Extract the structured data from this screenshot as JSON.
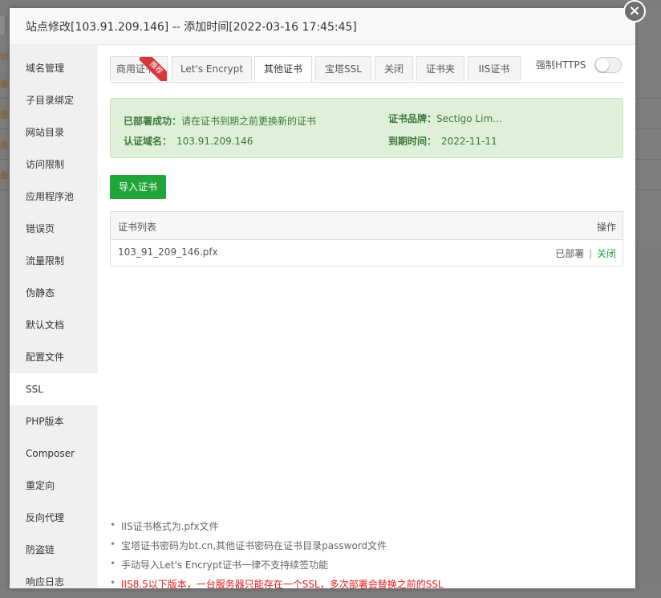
{
  "modal": {
    "title": "站点修改[103.91.209.146] -- 添加时间[2022-03-16 17:45:45]",
    "close_icon": "×"
  },
  "background": {
    "left_texts": [
      "价",
      "备",
      "备",
      "备",
      "备"
    ]
  },
  "sidebar": {
    "items": [
      {
        "label": "域名管理"
      },
      {
        "label": "子目录绑定"
      },
      {
        "label": "网站目录"
      },
      {
        "label": "访问限制"
      },
      {
        "label": "应用程序池"
      },
      {
        "label": "错误页"
      },
      {
        "label": "流量限制"
      },
      {
        "label": "伪静态"
      },
      {
        "label": "默认文档"
      },
      {
        "label": "配置文件"
      },
      {
        "label": "SSL"
      },
      {
        "label": "PHP版本"
      },
      {
        "label": "Composer"
      },
      {
        "label": "重定向"
      },
      {
        "label": "反向代理"
      },
      {
        "label": "防盗链"
      },
      {
        "label": "响应日志"
      }
    ],
    "active": "SSL"
  },
  "tabs": {
    "items": [
      {
        "label": "商用证书",
        "badge": "推荐"
      },
      {
        "label": "Let's Encrypt"
      },
      {
        "label": "其他证书"
      },
      {
        "label": "宝塔SSL"
      },
      {
        "label": "关闭"
      },
      {
        "label": "证书夹"
      },
      {
        "label": "IIS证书"
      }
    ],
    "active": "其他证书",
    "https_label": "强制HTTPS",
    "https_enabled": false
  },
  "alert": {
    "deploy_label": "已部署成功：",
    "deploy_text": "请在证书到期之前更换新的证书",
    "domain_label": "认证域名：",
    "domain_value": "103.91.209.146",
    "brand_label": "证书品牌：",
    "brand_value": "Sectigo Lim...",
    "expire_label": "到期时间：",
    "expire_value": "2022-11-11"
  },
  "import_button": "导入证书",
  "cert_table": {
    "header_name": "证书列表",
    "header_action": "操作",
    "rows": [
      {
        "name": "103_91_209_146.pfx",
        "status": "已部署",
        "separator": "|",
        "action": "关闭"
      }
    ]
  },
  "tips": [
    "IIS证书格式为.pfx文件",
    "宝塔证书密码为bt.cn,其他证书密码在证书目录password文件",
    "手动导入Let's Encrypt证书一律不支持续签功能",
    "IIS8.5以下版本，一台服务器只能存在一个SSL，多次部署会替换之前的SSL"
  ]
}
